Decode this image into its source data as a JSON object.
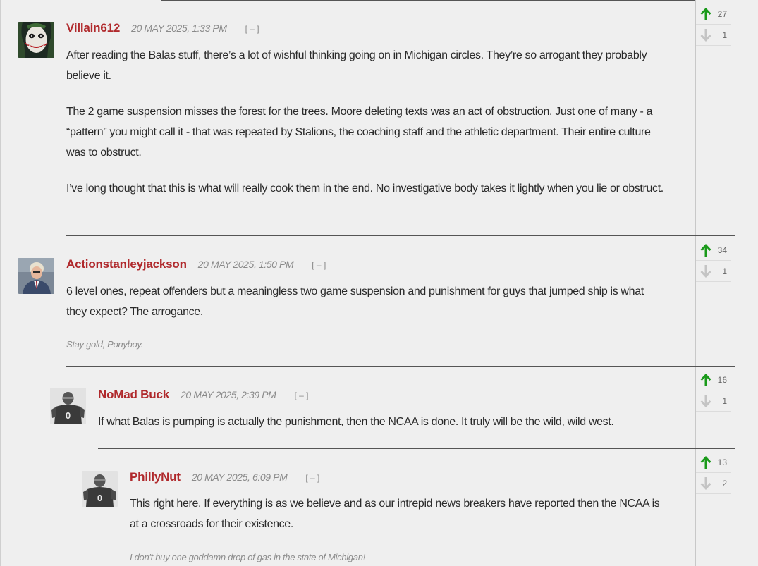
{
  "colors": {
    "author": "#b0292c",
    "upvote": "#1a9a1a",
    "downvote": "#c4c4c4",
    "background": "#efefef"
  },
  "comments": [
    {
      "author": "Villain612",
      "date": "20 MAY 2025, 1:33 PM",
      "collapse_label": "[ – ]",
      "avatar": "joker-avatar",
      "paragraphs": [
        "After reading the Balas stuff, there’s a lot of wishful thinking going on in Michigan circles. They’re so arrogant they probably believe it.",
        "The 2 game suspension misses the forest for the trees. Moore deleting texts was an act of obstruction. Just one of many - a “pattern” you might call it - that was repeated by Stalions, the coaching staff and the athletic department. Their entire culture was to obstruct.",
        "I’ve long thought that this is what will really cook them in the end. No investigative body takes it lightly when you lie or obstruct."
      ],
      "signature": "",
      "upvotes": "27",
      "downvotes": "1"
    },
    {
      "author": "Actionstanleyjackson",
      "date": "20 MAY 2025, 1:50 PM",
      "collapse_label": "[ – ]",
      "avatar": "photo-avatar",
      "paragraphs": [
        "6 level ones, repeat offenders but a meaningless two game suspension and punishment for guys that jumped ship is what they expect? The arrogance."
      ],
      "signature": "Stay gold, Ponyboy.",
      "upvotes": "34",
      "downvotes": "1"
    },
    {
      "author": "NoMad Buck",
      "date": "20 MAY 2025, 2:39 PM",
      "collapse_label": "[ – ]",
      "avatar": "default-player-avatar",
      "paragraphs": [
        "If what Balas is pumping is actually the punishment, then the NCAA is done. It truly will be the wild, wild west."
      ],
      "signature": "",
      "upvotes": "16",
      "downvotes": "1"
    },
    {
      "author": "PhillyNut",
      "date": "20 MAY 2025, 6:09 PM",
      "collapse_label": "[ – ]",
      "avatar": "default-player-avatar",
      "paragraphs": [
        "This right here. If everything is as we believe and as our intrepid news breakers have reported then the NCAA is at a crossroads for their existence."
      ],
      "signature": "I don't buy one goddamn drop of gas in the state of Michigan!",
      "upvotes": "13",
      "downvotes": "2"
    }
  ]
}
